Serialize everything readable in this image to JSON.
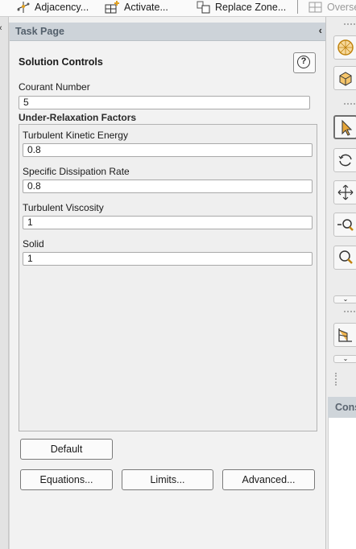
{
  "toolbar": {
    "items": [
      {
        "label": "Adjacency...",
        "icon": "adjacency-icon"
      },
      {
        "label": "Activate...",
        "icon": "grid-activate-icon"
      },
      {
        "label": "Replace Zone...",
        "icon": "replace-zone-icon"
      },
      {
        "label": "Overse",
        "icon": "overset-icon"
      }
    ]
  },
  "task_page": {
    "header_title": "Task Page",
    "section_title": "Solution Controls",
    "help_label": "?",
    "courant": {
      "label": "Courant Number",
      "value": "5"
    },
    "relaxation": {
      "title": "Under-Relaxation Factors",
      "fields": [
        {
          "label": "Turbulent Kinetic Energy",
          "value": "0.8"
        },
        {
          "label": "Specific Dissipation Rate",
          "value": "0.8"
        },
        {
          "label": "Turbulent Viscosity",
          "value": "1"
        },
        {
          "label": "Solid",
          "value": "1"
        }
      ]
    },
    "buttons": {
      "default": "Default",
      "equations": "Equations...",
      "limits": "Limits...",
      "advanced": "Advanced..."
    }
  },
  "console": {
    "header_title": "Cons"
  },
  "colors": {
    "header_bg": "#cdd3d9",
    "header_text": "#54606c",
    "tool_accent": "#d08a14"
  }
}
